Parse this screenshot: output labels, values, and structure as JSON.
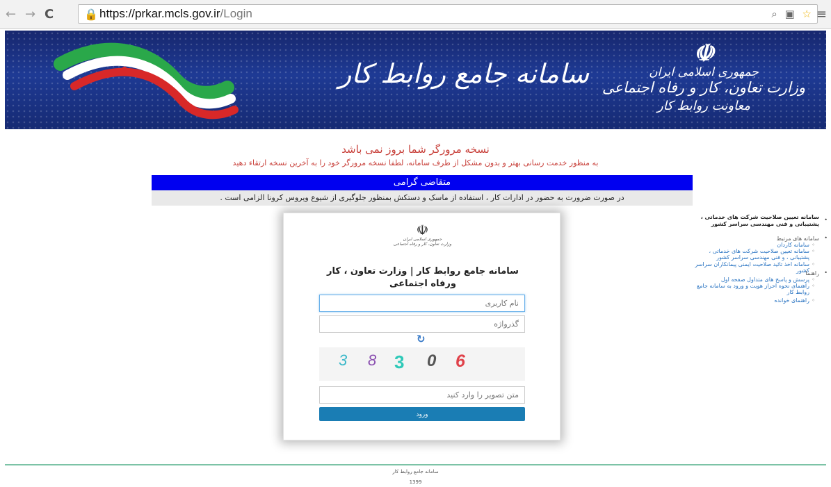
{
  "browser": {
    "url_base": "https://prkar.mcls.gov.ir",
    "url_path": "/Login"
  },
  "banner": {
    "title": "سامانه جامع روابط کار",
    "ministry_line1": "جمهوری اسلامی ایران",
    "ministry_line2": "وزارت تعاون، کار و رفاه اجتماعی",
    "ministry_line3": "معاونت روابط کار"
  },
  "warning": {
    "title": "نسخه مرورگر شما بروز نمی باشد",
    "subtitle": "به منظور خدمت رسانی بهتر و بدون مشکل از طرف سامانه، لطفا نسخه مرورگر خود را به آخرین نسخه ارتقاء دهید"
  },
  "announcement": {
    "header": "متقاضی گرامی",
    "text": "در صورت ضرورت به حضور در ادارات کار ، استفاده از ماسک و دستکش بمنظور جلوگیری از شیوع ویروس کرونا الزامی است ."
  },
  "login": {
    "logo_text_1": "جمهوری اسلامی ایران",
    "logo_text_2": "وزارت تعاون، کار و رفاه اجتماعی",
    "title": "سامانه جامع روابط کار | وزارت تعاون ، کار ورفاه اجتماعی",
    "username_placeholder": "نام کاربری",
    "password_placeholder": "گذرواژه",
    "captcha_digits": [
      "3",
      "8",
      "3",
      "0",
      "6"
    ],
    "captcha_colors": [
      "#3bb8c9",
      "#8a4fb0",
      "#2ec9b8",
      "#555555",
      "#e0424a"
    ],
    "captcha_placeholder": "متن تصویر را وارد کنید",
    "submit_label": "ورود"
  },
  "sidebar": {
    "heading": "سامانه تعیین صلاحیت شرکت های خدماتی ، پشتیبانی و فنی مهندسی سراسر کشور",
    "related_label": "سامانه های مرتبط",
    "related_links": [
      "سامانه کاردان",
      "سامانه تعیین صلاحیت شرکت های خدماتی ، پشتیبانی ، و فنی مهندسی سراسر کشور",
      "سامانه اخذ تائید صلاحیت ایمنی پیمانکاران سراسر کشور"
    ],
    "guide_label": "راهنما",
    "guide_links": [
      "پرسش و پاسخ های متداول صفحه اول",
      "راهنمای نحوه احراز هویت و ورود به سامانه جامع روابط کار",
      "راهنمای خوانده"
    ]
  },
  "footer": {
    "line1": "سامانه جامع روابط کار",
    "line2": "1399"
  }
}
